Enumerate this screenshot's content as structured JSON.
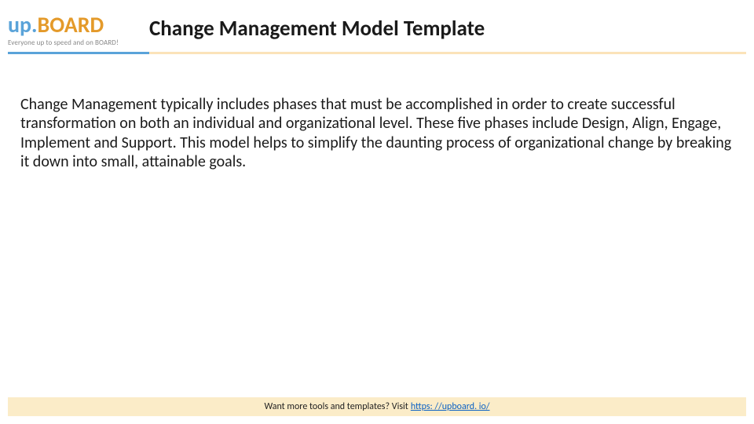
{
  "logo": {
    "prefix": "up.",
    "main": "BOARD",
    "tagline": "Everyone up to speed and on BOARD!"
  },
  "title": "Change Management Model Template",
  "body": "Change Management typically includes phases that must be accomplished in order to create successful transformation on both an individual and organizational level. These five phases include Design, Align, Engage, Implement and Support. This model helps to simplify the daunting process of organizational change by breaking it down into small, attainable goals.",
  "footer": {
    "prompt": "Want more tools and templates? Visit",
    "link_text": " https: //upboard. io/"
  }
}
